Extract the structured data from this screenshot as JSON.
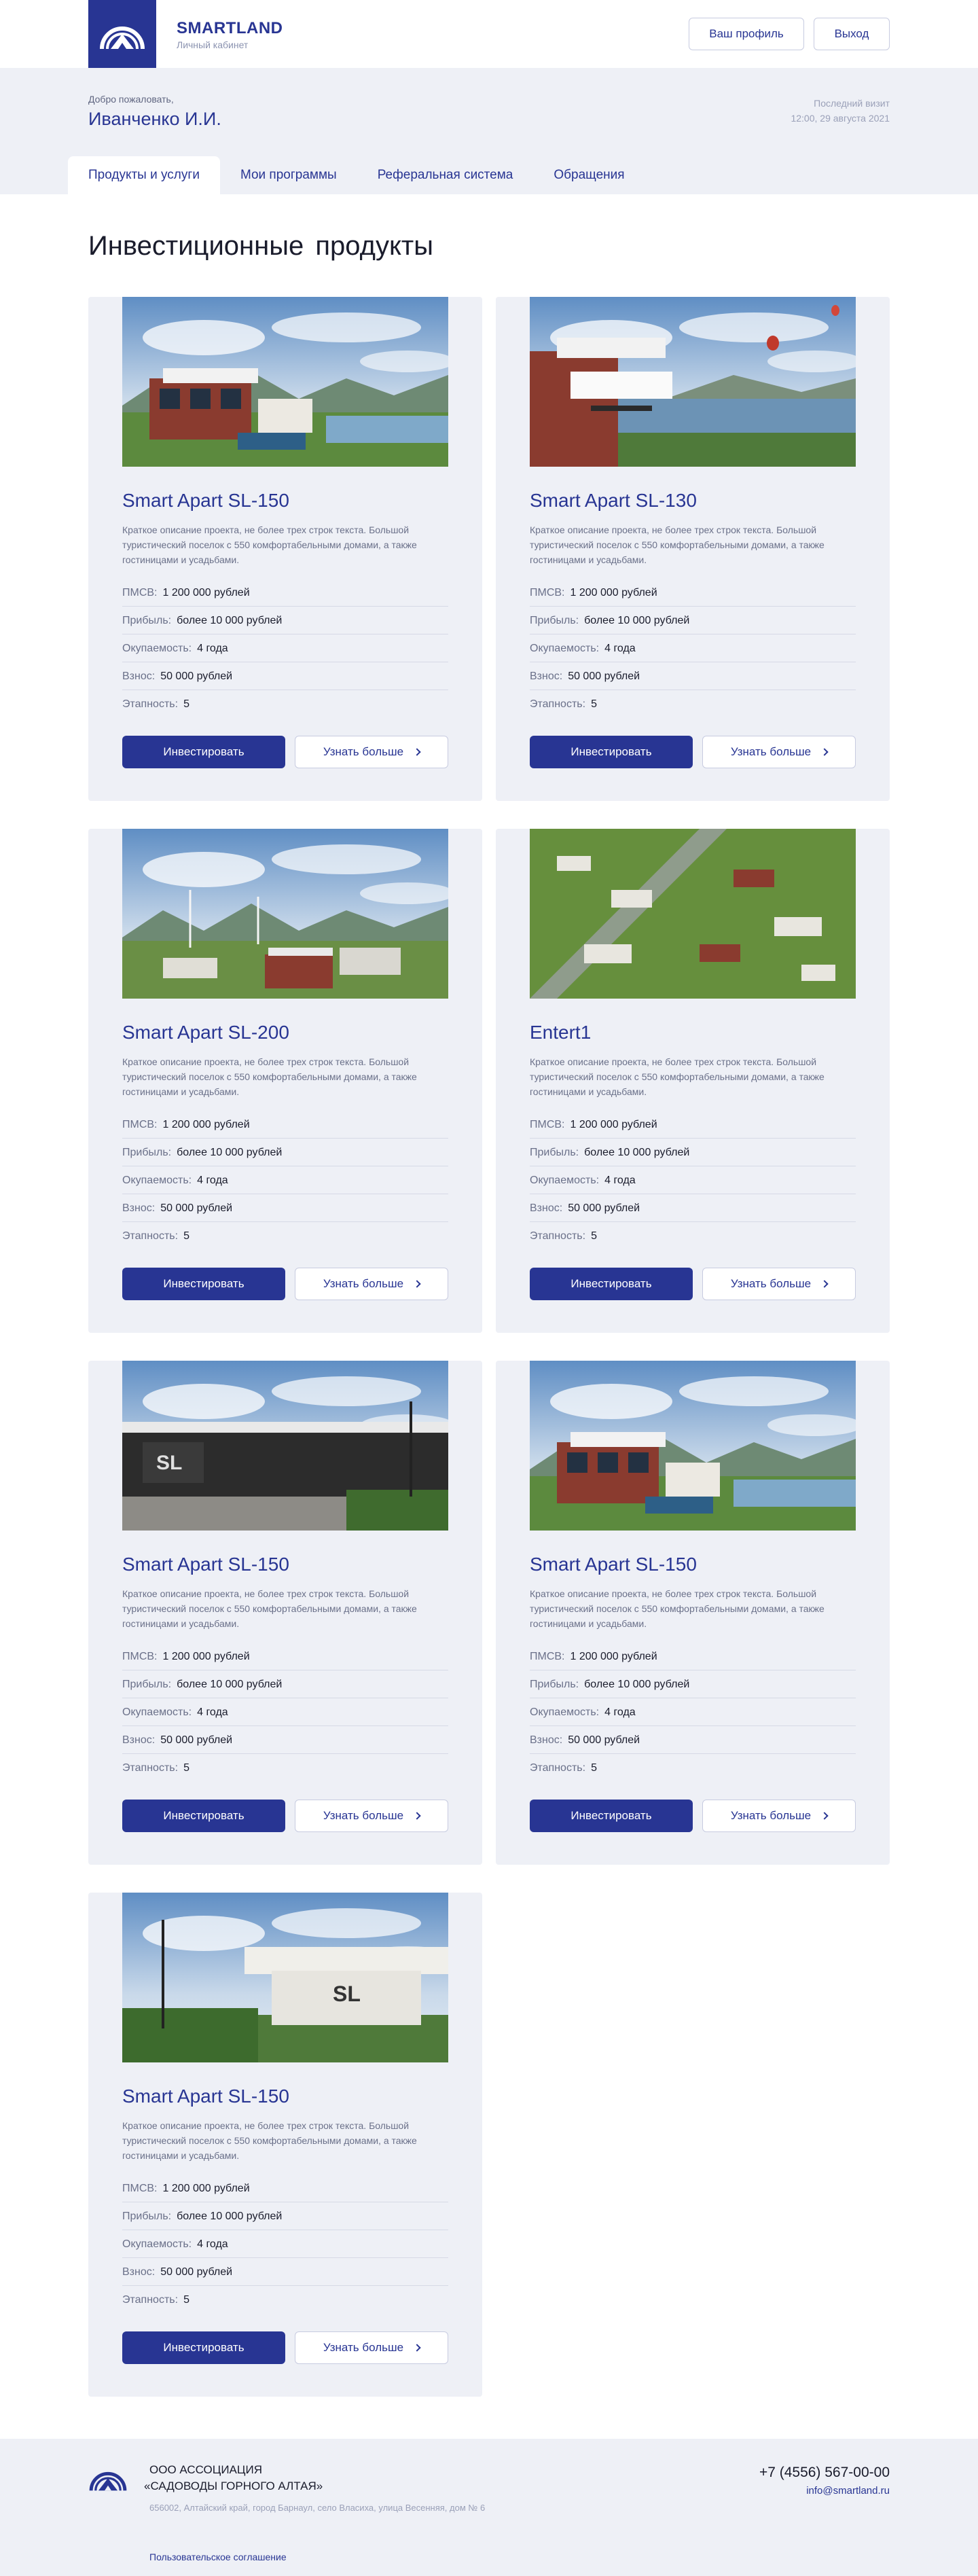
{
  "header": {
    "brand_name": "SMARTLAND",
    "brand_sub": "Личный кабинет",
    "profile_button": "Ваш профиль",
    "exit_button": "Выход"
  },
  "user": {
    "welcome": "Добро пожаловать,",
    "name": "Иванченко И.И.",
    "last_visit_label": "Последний визит",
    "last_visit_value": "12:00, 29 августа 2021"
  },
  "tabs": [
    {
      "label": "Продукты и услуги",
      "active": true
    },
    {
      "label": "Мои программы",
      "active": false
    },
    {
      "label": "Реферальная система",
      "active": false
    },
    {
      "label": "Обращения",
      "active": false
    }
  ],
  "page_title": "Инвестиционные  продукты",
  "spec_labels": {
    "pmsv": "ПМСВ:",
    "profit": "Прибыль:",
    "payback": "Окупаемость:",
    "fee": "Взнос:",
    "floors": "Этапность:"
  },
  "buttons": {
    "invest": "Инвестировать",
    "more": "Узнать больше"
  },
  "products": [
    {
      "title": "Smart Apart SL-150",
      "image": "house-lake",
      "desc": "Краткое описание проекта, не более трех строк текста. Большой туристический поселок с 550 комфортабельными домами, а также гостиницами и усадьбами.",
      "pmsv": "1 200 000 рублей",
      "profit": "более 10 000 рублей",
      "payback": "4 года",
      "fee": "50 000 рублей",
      "floors": "5"
    },
    {
      "title": "Smart Apart SL-130",
      "image": "house-balloons",
      "desc": "Краткое описание проекта, не более трех строк текста. Большой туристический поселок с 550 комфортабельными домами, а также гостиницами и усадьбами.",
      "pmsv": "1 200 000 рублей",
      "profit": "более 10 000 рублей",
      "payback": "4 года",
      "fee": "50 000 рублей",
      "floors": "5"
    },
    {
      "title": "Smart Apart SL-200",
      "image": "village-windmills",
      "desc": "Краткое описание проекта, не более трех строк текста. Большой туристический поселок с 550 комфортабельными домами, а также гостиницами и усадьбами.",
      "pmsv": "1 200 000 рублей",
      "profit": "более 10 000 рублей",
      "payback": "4 года",
      "fee": "50 000 рублей",
      "floors": "5"
    },
    {
      "title": "Entert1",
      "image": "village-aerial",
      "desc": "Краткое описание проекта, не более трех строк текста. Большой туристический поселок с 550 комфортабельными домами, а также гостиницами и усадьбами.",
      "pmsv": "1 200 000 рублей",
      "profit": "более 10 000 рублей",
      "payback": "4 года",
      "fee": "50 000 рублей",
      "floors": "5"
    },
    {
      "title": "Smart Apart SL-150",
      "image": "sl-building-street",
      "desc": "Краткое описание проекта, не более трех строк текста. Большой туристический поселок с 550 комфортабельными домами, а также гостиницами и усадьбами.",
      "pmsv": "1 200 000 рублей",
      "profit": "более 10 000 рублей",
      "payback": "4 года",
      "fee": "50 000 рублей",
      "floors": "5"
    },
    {
      "title": "Smart Apart SL-150",
      "image": "house-lake-2",
      "desc": "Краткое описание проекта, не более трех строк текста. Большой туристический поселок с 550 комфортабельными домами, а также гостиницами и усадьбами.",
      "pmsv": "1 200 000 рублей",
      "profit": "более 10 000 рублей",
      "payback": "4 года",
      "fee": "50 000 рублей",
      "floors": "5"
    },
    {
      "title": "Smart Apart SL-150",
      "image": "sl-building-garden",
      "desc": "Краткое описание проекта, не более трех строк текста. Большой туристический поселок с 550 комфортабельными домами, а также гостиницами и усадьбами.",
      "pmsv": "1 200 000 рублей",
      "profit": "более 10 000 рублей",
      "payback": "4 года",
      "fee": "50 000 рублей",
      "floors": "5"
    }
  ],
  "footer": {
    "org_line1": "ООО АССОЦИАЦИЯ",
    "org_line2": "«САДОВОДЫ ГОРНОГО АЛТАЯ»",
    "address": "656002, Алтайский край, город Барнаул, село Власиха, улица Весенняя, дом № 6",
    "phone": "+7 (4556) 567-00-00",
    "email": "info@smartland.ru",
    "agreement": "Пользовательское соглашение"
  },
  "colors": {
    "brand": "#283593",
    "panel": "#eef0f6",
    "muted": "#6a7089"
  }
}
